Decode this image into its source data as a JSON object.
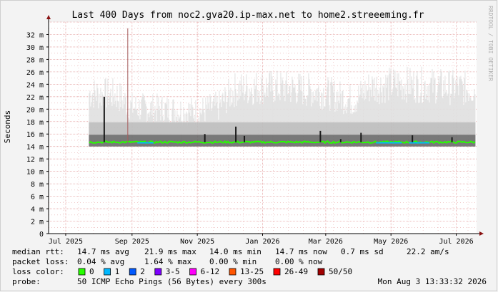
{
  "chart_data": {
    "type": "area",
    "title": "Last 400 Days from noc2.gva20.ip-max.net to home2.streeeming.fr",
    "ylabel": "Seconds",
    "watermark": "RRDTOOL / TOBI OETIKER",
    "ylim": [
      0,
      0.034
    ],
    "yticks": [
      {
        "v": 0,
        "label": "0"
      },
      {
        "v": 0.002,
        "label": "2 m"
      },
      {
        "v": 0.004,
        "label": "4 m"
      },
      {
        "v": 0.006,
        "label": "6 m"
      },
      {
        "v": 0.008,
        "label": "8 m"
      },
      {
        "v": 0.01,
        "label": "10 m"
      },
      {
        "v": 0.012,
        "label": "12 m"
      },
      {
        "v": 0.014,
        "label": "14 m"
      },
      {
        "v": 0.016,
        "label": "16 m"
      },
      {
        "v": 0.018,
        "label": "18 m"
      },
      {
        "v": 0.02,
        "label": "20 m"
      },
      {
        "v": 0.022,
        "label": "22 m"
      },
      {
        "v": 0.024,
        "label": "24 m"
      },
      {
        "v": 0.026,
        "label": "26 m"
      },
      {
        "v": 0.028,
        "label": "28 m"
      },
      {
        "v": 0.03,
        "label": "30 m"
      },
      {
        "v": 0.032,
        "label": "32 m"
      }
    ],
    "x_range": [
      "2025-06-29",
      "2026-08-03"
    ],
    "xticks": [
      {
        "date": "2025-07-15",
        "label": "Jul 2025"
      },
      {
        "date": "2025-09-15",
        "label": "Sep 2025"
      },
      {
        "date": "2025-11-15",
        "label": "Nov 2025"
      },
      {
        "date": "2026-01-15",
        "label": "Jan 2026"
      },
      {
        "date": "2026-03-15",
        "label": "Mar 2026"
      },
      {
        "date": "2026-05-15",
        "label": "May 2026"
      },
      {
        "date": "2026-07-15",
        "label": "Jul 2026"
      }
    ],
    "data_start": "2025-08-06",
    "median_baseline": 0.0147,
    "smoke_envelope": [
      {
        "date": "2025-08-06",
        "max": 0.0254
      },
      {
        "date": "2025-09-01",
        "max": 0.025
      },
      {
        "date": "2025-09-15",
        "max": 0.0228
      },
      {
        "date": "2025-10-15",
        "max": 0.0225
      },
      {
        "date": "2025-11-15",
        "max": 0.022
      },
      {
        "date": "2025-12-05",
        "max": 0.023
      },
      {
        "date": "2025-12-20",
        "max": 0.026
      },
      {
        "date": "2026-01-15",
        "max": 0.0265
      },
      {
        "date": "2026-02-15",
        "max": 0.0262
      },
      {
        "date": "2026-03-15",
        "max": 0.0255
      },
      {
        "date": "2026-04-10",
        "max": 0.024
      },
      {
        "date": "2026-04-25",
        "max": 0.0265
      },
      {
        "date": "2026-05-20",
        "max": 0.027
      },
      {
        "date": "2026-06-20",
        "max": 0.0268
      },
      {
        "date": "2026-07-25",
        "max": 0.0262
      }
    ],
    "spikes": [
      {
        "date": "2025-08-20",
        "value": 0.022
      },
      {
        "date": "2025-09-11",
        "value": 0.033
      },
      {
        "date": "2025-11-22",
        "value": 0.016
      },
      {
        "date": "2025-12-21",
        "value": 0.0172
      },
      {
        "date": "2025-12-29",
        "value": 0.0157
      },
      {
        "date": "2026-03-10",
        "value": 0.0165
      },
      {
        "date": "2026-03-29",
        "value": 0.0152
      },
      {
        "date": "2026-04-17",
        "value": 0.0162
      },
      {
        "date": "2026-06-04",
        "value": 0.0158
      },
      {
        "date": "2026-07-11",
        "value": 0.0155
      }
    ],
    "stats": {
      "rtt_label": "median rtt:",
      "rtt_avg": "14.7 ms avg",
      "rtt_max": "21.9 ms max",
      "rtt_min": "14.0 ms min",
      "rtt_now": "14.7 ms now",
      "rtt_sd": "0.7 ms sd",
      "rtt_ams": "22.2   am/s",
      "loss_label": "packet loss:",
      "loss_avg": "0.04 % avg",
      "loss_max": "1.64 % max",
      "loss_min": "0.00 % min",
      "loss_now": "0.00 % now"
    },
    "loss_legend_label": "loss color:",
    "loss_legend": [
      {
        "label": "0",
        "color": "#26ff00"
      },
      {
        "label": "1",
        "color": "#00b8ff"
      },
      {
        "label": "2",
        "color": "#0059ff"
      },
      {
        "label": "3-5",
        "color": "#7e00ff"
      },
      {
        "label": "6-12",
        "color": "#ff00fa"
      },
      {
        "label": "13-25",
        "color": "#ff5500"
      },
      {
        "label": "26-49",
        "color": "#ff0000"
      },
      {
        "label": "50/50",
        "color": "#a10000"
      }
    ],
    "probe_label": "probe:",
    "probe_text": "50 ICMP Echo Pings (56 Bytes) every 300s",
    "timestamp": "Mon Aug  3 13:33:32 2026",
    "colors": {
      "background": "#f3f3f3",
      "plot_bg": "#ffffff",
      "grid": "#e6a7a7",
      "median_line": "#26ff00",
      "smoke": "#b4b4b4",
      "axis": "#000000",
      "arrow": "#8a1111",
      "text": "#000000"
    }
  }
}
